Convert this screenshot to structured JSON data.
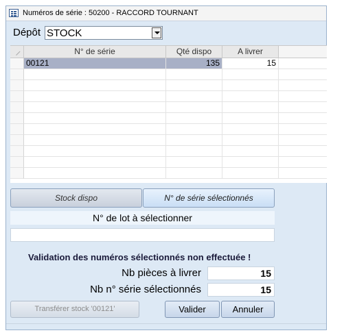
{
  "window": {
    "title": "Numéros de série : 50200 - RACCORD TOURNANT"
  },
  "depot": {
    "label": "Dépôt",
    "selected": "STOCK"
  },
  "grid": {
    "columns": [
      "N° de série",
      "Qté dispo",
      "A livrer"
    ],
    "rows": [
      {
        "serie": "00121",
        "qte_dispo": "135",
        "a_livrer": "15"
      }
    ],
    "empty_rows": 10
  },
  "tabs": {
    "stock_dispo": "Stock dispo",
    "series_selected": "N° de série sélectionnés"
  },
  "lot": {
    "label": "N° de lot à sélectionner",
    "value": ""
  },
  "validation": {
    "message": "Validation des numéros sélectionnés non effectuée !"
  },
  "stats": {
    "nb_pieces_label": "Nb pièces à livrer",
    "nb_pieces_value": "15",
    "nb_series_label": "Nb n° série sélectionnés",
    "nb_series_value": "15"
  },
  "buttons": {
    "transfer": "Transférer stock '00121'",
    "valider": "Valider",
    "annuler": "Annuler"
  },
  "colors": {
    "background": "#dde9f5",
    "selected_row": "#a8b0c6",
    "tab_active": "#c9def5"
  }
}
